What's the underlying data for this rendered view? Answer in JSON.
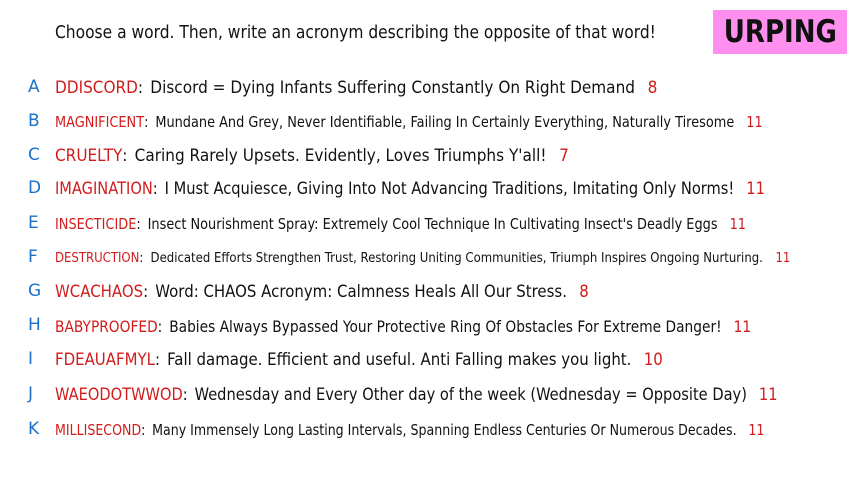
{
  "prompt": "Choose a word. Then, write an acronym describing the opposite of that word!",
  "badge": "URPING",
  "colors": {
    "letter": "#1a73c9",
    "word": "#d21c1c",
    "score": "#d21c1c",
    "badge_bg": "#ff8fef",
    "text": "#111111"
  },
  "entries": [
    {
      "letter": "A",
      "word": "DDISCORD",
      "text": "Discord = Dying Infants Suffering Constantly On Right Demand",
      "score": "8"
    },
    {
      "letter": "B",
      "word": "MAGNIFICENT",
      "text": "Mundane And Grey, Never Identifiable, Failing In Certainly Everything, Naturally Tiresome",
      "score": "11"
    },
    {
      "letter": "C",
      "word": "CRUELTY",
      "text": "Caring Rarely Upsets. Evidently, Loves Triumphs Y'all!",
      "score": "7"
    },
    {
      "letter": "D",
      "word": "IMAGINATION",
      "text": "I Must Acquiesce, Giving Into Not Advancing Traditions, Imitating Only Norms!",
      "score": "11"
    },
    {
      "letter": "E",
      "word": "INSECTICIDE",
      "text": "Insect Nourishment Spray: Extremely Cool Technique In Cultivating Insect's Deadly Eggs",
      "score": "11"
    },
    {
      "letter": "F",
      "word": "DESTRUCTION",
      "text": "Dedicated Efforts Strengthen Trust, Restoring Uniting Communities, Triumph Inspires Ongoing Nurturing.",
      "score": "11"
    },
    {
      "letter": "G",
      "word": "WCACHAOS",
      "text": "Word: CHAOS  Acronym: Calmness Heals All Our Stress.",
      "score": "8"
    },
    {
      "letter": "H",
      "word": "BABYPROOFED",
      "text": "Babies Always Bypassed Your Protective Ring Of  Obstacles For Extreme Danger!",
      "score": "11"
    },
    {
      "letter": "I",
      "word": "FDEAUAFMYL",
      "text": "Fall damage. Efficient and useful. Anti Falling makes you light.",
      "score": "10"
    },
    {
      "letter": "J",
      "word": "WAEODOTWWOD",
      "text": "Wednesday and Every Other day of the week (Wednesday = Opposite Day)",
      "score": "11"
    },
    {
      "letter": "K",
      "word": "MILLISECOND",
      "text": "Many Immensely Long Lasting Intervals, Spanning Endless Centuries Or Numerous Decades.",
      "score": "11"
    }
  ]
}
